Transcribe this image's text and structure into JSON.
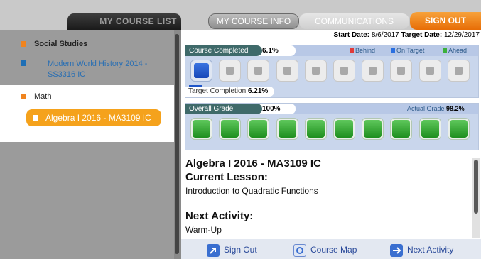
{
  "sidebar": {
    "tab_label": "MY COURSE LIST",
    "groups": [
      {
        "name": "Social Studies",
        "color": "#f0841f",
        "courses": [
          {
            "name": "Modern World History 2014 - SS3316 IC",
            "color": "#1e6fb6"
          }
        ]
      },
      {
        "name": "Math",
        "color": "#f0841f",
        "courses": [
          {
            "name": "Algebra I 2016 - MA3109 IC",
            "selected": true
          }
        ]
      }
    ]
  },
  "header": {
    "tabs": [
      {
        "label": "MY COURSE INFO",
        "active": true
      },
      {
        "label": "COMMUNICATIONS",
        "active": false
      }
    ],
    "sign_out_label": "SIGN OUT"
  },
  "dates": {
    "start_label": "Start Date:",
    "start": "8/6/2017",
    "target_label": "Target Date:",
    "target": "12/29/2017"
  },
  "course_completed": {
    "label": "Course Completed",
    "value": "6.1%",
    "fraction": 0.061,
    "target_label": "Target Completion",
    "target_value": "6.21%",
    "legend": [
      {
        "label": "Behind",
        "color": "#e03a3a"
      },
      {
        "label": "On Target",
        "color": "#2a6fe0"
      },
      {
        "label": "Ahead",
        "color": "#3bb03b"
      }
    ],
    "segments": 10,
    "segments_filled": 1
  },
  "overall_grade": {
    "label": "Overall Grade",
    "value": "100%",
    "actual_label": "Actual Grade",
    "actual_value": "98.2%",
    "segments": 10,
    "segments_filled": 10
  },
  "course_info": {
    "course_name": "Algebra I 2016 - MA3109 IC",
    "current_lesson_label": "Current Lesson:",
    "current_lesson": "Introduction to Quadratic Functions",
    "next_activity_label": "Next Activity:",
    "next_activity": "Warm-Up"
  },
  "footer": {
    "sign_out": "Sign Out",
    "course_map": "Course Map",
    "next_activity": "Next Activity"
  }
}
